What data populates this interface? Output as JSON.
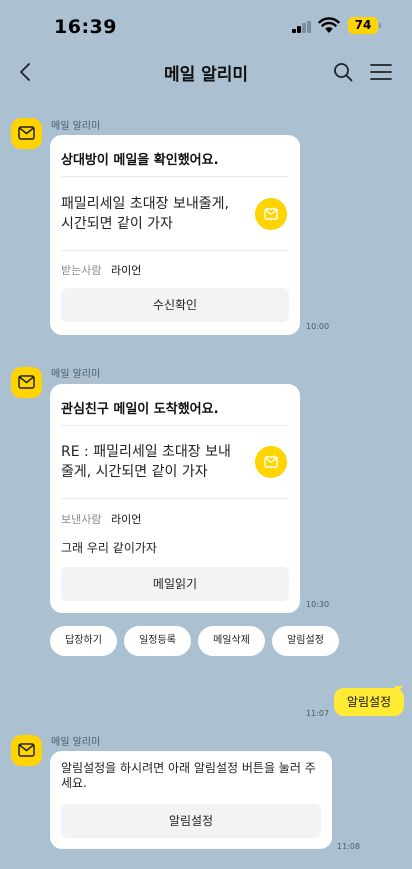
{
  "status_bar": {
    "time": "16:39",
    "battery": "74"
  },
  "header": {
    "title": "메일 알리미"
  },
  "icons": {
    "back": "chevron-left-icon",
    "search": "search-icon",
    "menu": "hamburger-menu-icon",
    "mail": "envelope-icon"
  },
  "colors": {
    "background": "#abc1d1",
    "accent": "#ffd400",
    "user_bubble": "#ffeb33"
  },
  "messages": [
    {
      "sender": "메일 알리미",
      "title": "상대방이 메일을 확인했어요.",
      "subject": "패밀리세일 초대장 보내줄게, 시간되면 같이 가자",
      "meta_label": "받는사람",
      "meta_value": "라이언",
      "button": "수신확인",
      "time": "10:00"
    },
    {
      "sender": "메일 알리미",
      "title": "관심친구 메일이 도착했어요.",
      "subject": "RE : 패밀리세일 초대장 보내줄게, 시간되면 같이 가자",
      "meta_label": "보낸사람",
      "meta_value": "라이언",
      "body": "그래 우리 같이가자",
      "button": "메일읽기",
      "time": "10:30"
    }
  ],
  "quick_replies": [
    "답장하기",
    "일정등록",
    "메일삭제",
    "알림설정"
  ],
  "user_message": {
    "text": "알림설정",
    "time": "11:07"
  },
  "notice": {
    "sender": "메일 알리미",
    "text": "알림설정을 하시려면 아래 알림설정 버튼을 눌러 주세요.",
    "button": "알림설정",
    "time": "11:08"
  }
}
